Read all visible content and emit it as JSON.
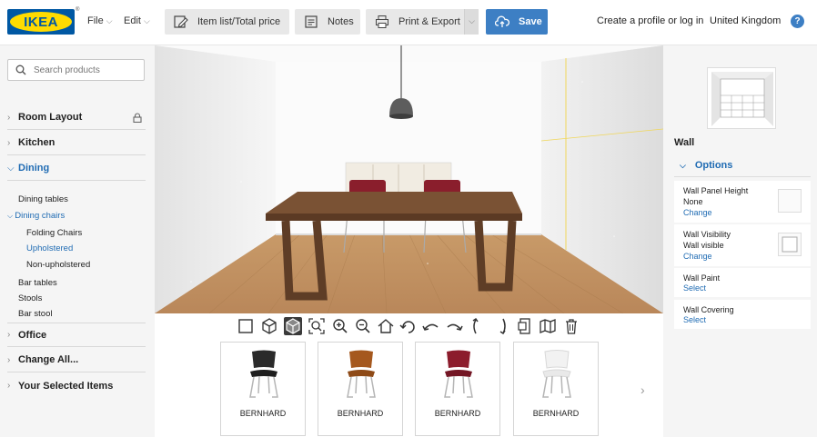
{
  "header": {
    "logo": "IKEA",
    "menus": [
      {
        "label": "File"
      },
      {
        "label": "Edit"
      }
    ],
    "buttons": {
      "item_list": "Item list/Total price",
      "notes": "Notes",
      "print_export": "Print & Export",
      "save": "Save"
    },
    "profile_link": "Create a profile or log in",
    "country": "United Kingdom",
    "help": "?"
  },
  "sidebar": {
    "search_placeholder": "Search products",
    "categories": [
      {
        "label": "Room Layout",
        "locked": true
      },
      {
        "label": "Kitchen"
      },
      {
        "label": "Dining",
        "expanded": true
      }
    ],
    "dining_items": [
      {
        "label": "Dining tables"
      },
      {
        "label": "Dining chairs",
        "expanded": true
      },
      {
        "label": "Folding Chairs"
      },
      {
        "label": "Upholstered",
        "selected": true
      },
      {
        "label": "Non-upholstered"
      },
      {
        "label": "Bar tables"
      },
      {
        "label": "Stools"
      },
      {
        "label": "Bar stool"
      }
    ],
    "lower_categories": [
      {
        "label": "Office"
      },
      {
        "label": "Change All..."
      },
      {
        "label": "Your Selected Items"
      }
    ]
  },
  "toolbar3d": {
    "tools": [
      "2d-view-icon",
      "3d-view-icon",
      "3d-solid-view-icon",
      "zoom-fit-icon",
      "zoom-in-icon",
      "zoom-out-icon",
      "home-icon",
      "rotate-left-icon",
      "tilt-up-icon",
      "tilt-down-icon",
      "rotate-right-icon",
      "orbit-icon",
      "camera-icon",
      "map-icon",
      "trash-icon"
    ],
    "active_tool": "3d-solid-view-icon"
  },
  "products": [
    {
      "name": "BERNHARD",
      "color": "#2a2a2a"
    },
    {
      "name": "BERNHARD",
      "color": "#a5581e"
    },
    {
      "name": "BERNHARD",
      "color": "#8c1c2c"
    },
    {
      "name": "BERNHARD",
      "color": "#f2f2f2"
    }
  ],
  "right_panel": {
    "title": "Wall",
    "options_label": "Options",
    "rows": [
      {
        "label": "Wall Panel Height",
        "value": "None",
        "action": "Change"
      },
      {
        "label": "Wall Visibility",
        "value": "Wall visible",
        "action": "Change"
      },
      {
        "label": "Wall Paint",
        "action": "Select"
      },
      {
        "label": "Wall Covering",
        "action": "Select"
      }
    ]
  },
  "colors": {
    "ikea_blue": "#0058a3",
    "ikea_yellow": "#ffdb00",
    "accent": "#1f6bb3",
    "save_button": "#3d7fc4"
  }
}
